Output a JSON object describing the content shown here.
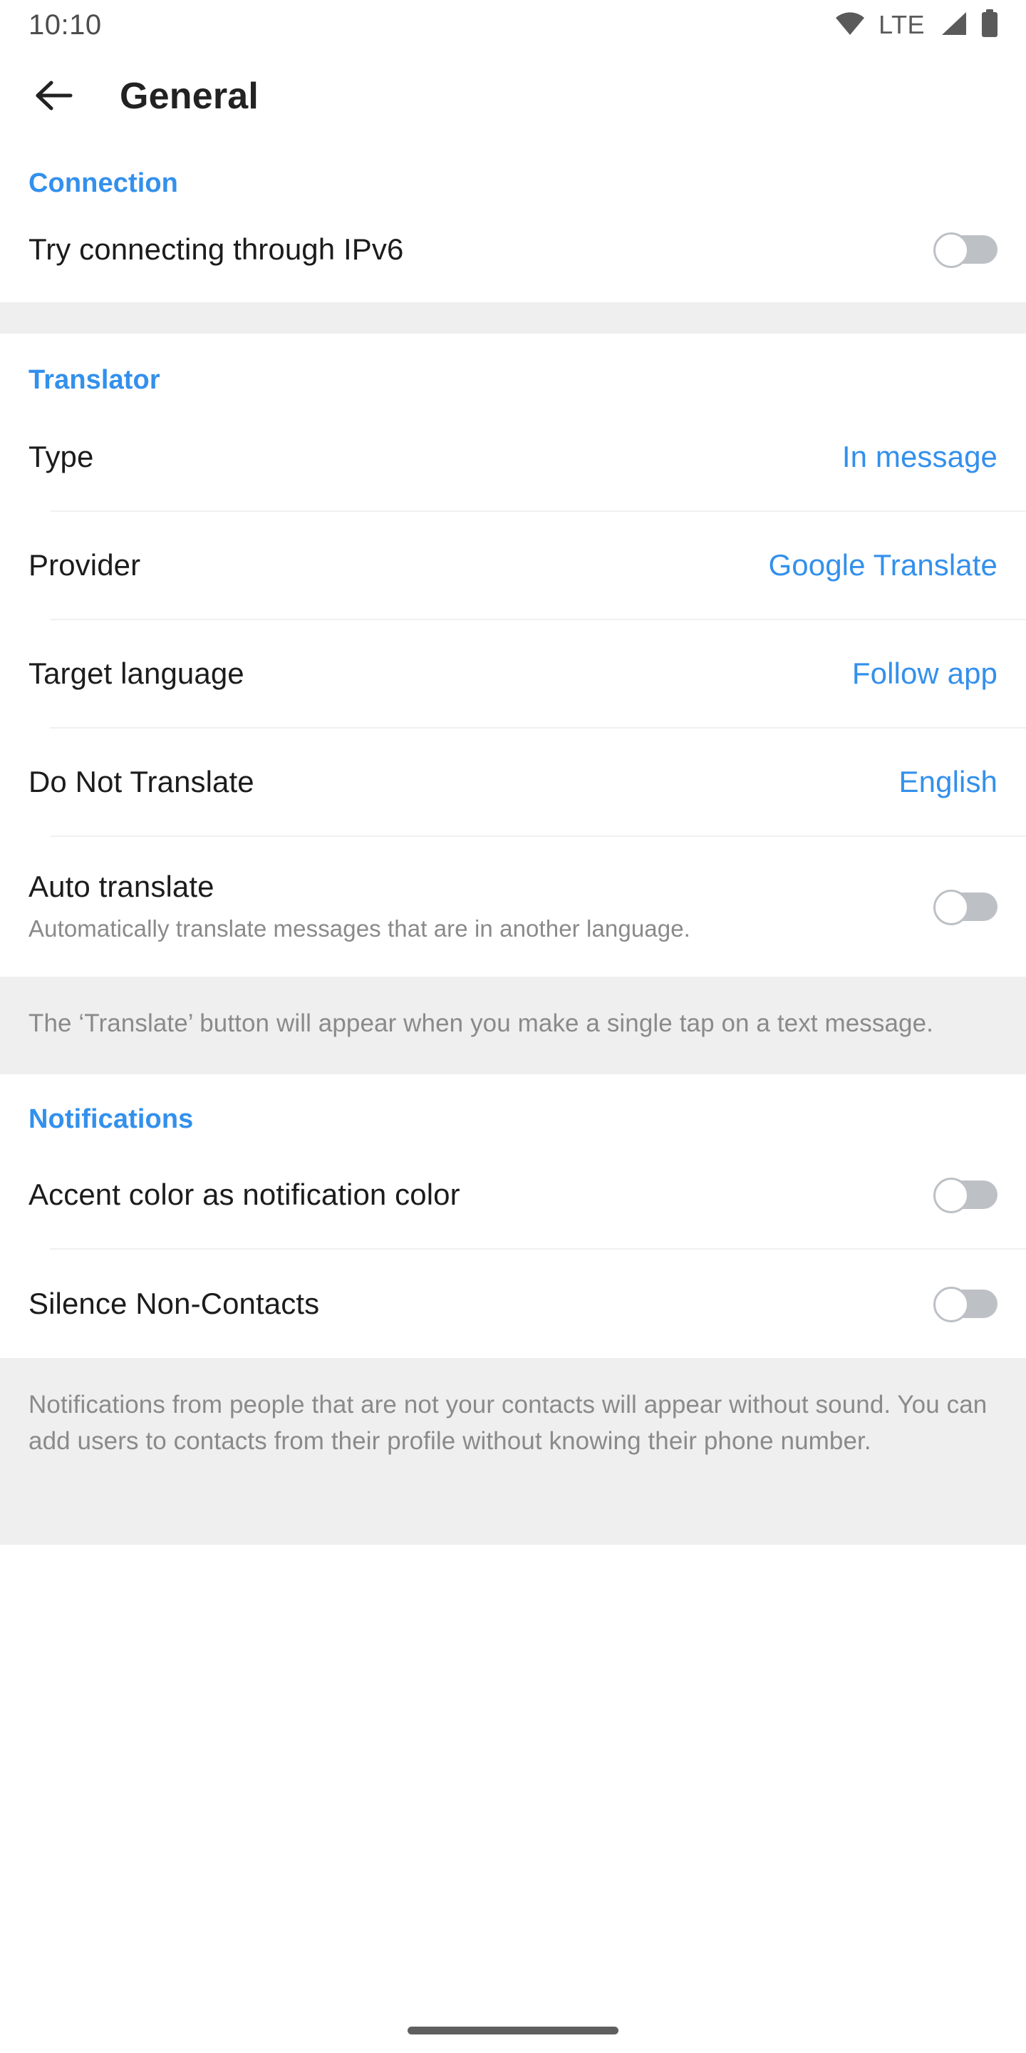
{
  "status_bar": {
    "time": "10:10",
    "network_label": "LTE",
    "icons": [
      "wifi-icon",
      "signal-icon",
      "battery-icon"
    ]
  },
  "app_bar": {
    "back_icon": "back-arrow-icon",
    "title": "General"
  },
  "colors": {
    "accent": "#3390ec",
    "label": "#1c1c1c",
    "secondary": "#8a8a8a",
    "band": "#efefef",
    "divider": "#f0f0f0",
    "toggle_off_track": "#bdc1c6"
  },
  "sections": [
    {
      "title": "Connection",
      "rows": [
        {
          "label": "Try connecting through IPv6",
          "type": "toggle",
          "value": "off"
        }
      ]
    },
    {
      "title": "Translator",
      "rows": [
        {
          "label": "Type",
          "type": "value",
          "value": "In message"
        },
        {
          "label": "Provider",
          "type": "value",
          "value": "Google Translate"
        },
        {
          "label": "Target language",
          "type": "value",
          "value": "Follow app"
        },
        {
          "label": "Do Not Translate",
          "type": "value",
          "value": "English"
        },
        {
          "label": "Auto translate",
          "subtitle": "Automatically translate messages that are in another language.",
          "type": "toggle",
          "value": "off"
        }
      ],
      "note": "The ‘Translate’ button will appear when you make a single tap on a text message."
    },
    {
      "title": "Notifications",
      "rows": [
        {
          "label": "Accent color as notification color",
          "type": "toggle",
          "value": "off"
        },
        {
          "label": "Silence Non-Contacts",
          "type": "toggle",
          "value": "off"
        }
      ],
      "note": "Notifications from people that are not your contacts will appear without sound. You can add users to contacts from their profile without knowing their phone number."
    }
  ]
}
